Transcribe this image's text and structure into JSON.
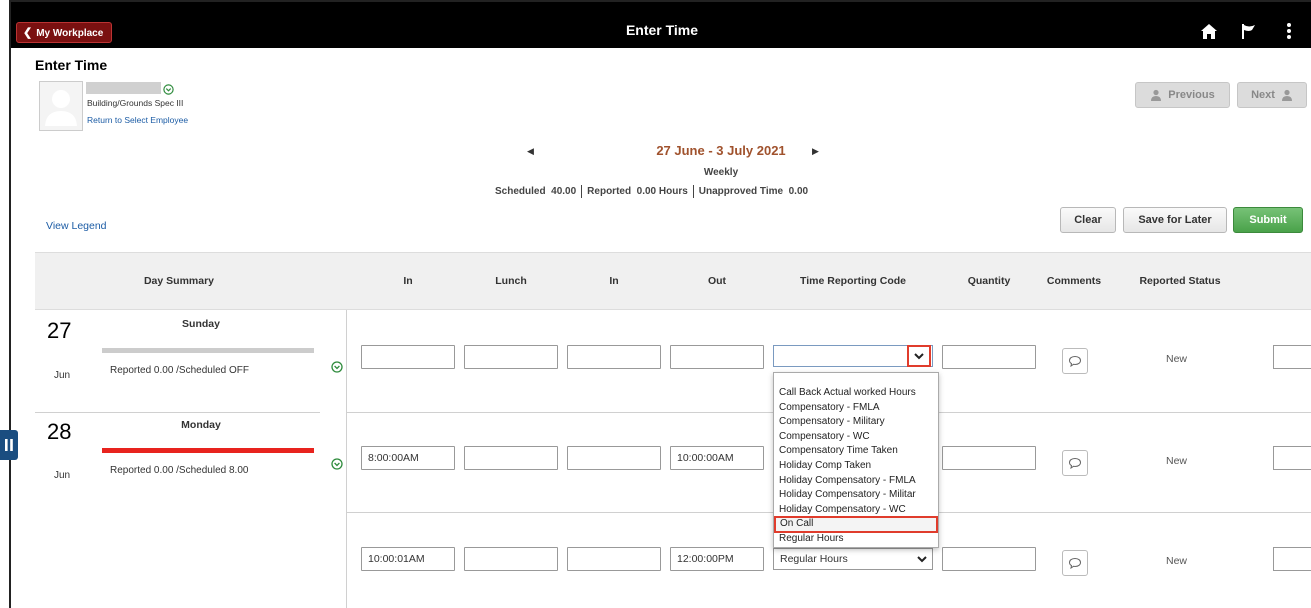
{
  "header": {
    "back_label": "My Workplace",
    "title": "Enter Time"
  },
  "page": {
    "title": "Enter Time"
  },
  "employee": {
    "job_title": "Building/Grounds Spec III",
    "return_link": "Return to Select Employee"
  },
  "nav": {
    "previous": "Previous",
    "next": "Next"
  },
  "period": {
    "range": "27 June - 3 July 2021",
    "view": "Weekly"
  },
  "summary": {
    "scheduled_label": "Scheduled",
    "scheduled_value": "40.00",
    "reported_label": "Reported",
    "reported_value": "0.00 Hours",
    "unapproved_label": "Unapproved Time",
    "unapproved_value": "0.00"
  },
  "actions": {
    "view_legend": "View Legend",
    "clear": "Clear",
    "save_for_later": "Save for Later",
    "submit": "Submit"
  },
  "columns": [
    "Day Summary",
    "In",
    "Lunch",
    "In",
    "Out",
    "Time Reporting Code",
    "Quantity",
    "Comments",
    "Reported Status"
  ],
  "days": [
    {
      "num": "27",
      "month": "Jun",
      "name": "Sunday",
      "reported": "Reported 0.00 /Scheduled OFF",
      "bar_color": "#cccccc"
    },
    {
      "num": "28",
      "month": "Jun",
      "name": "Monday",
      "reported": "Reported 0.00 /Scheduled 8.00",
      "bar_color": "#e8231e"
    }
  ],
  "rows": [
    {
      "in": "",
      "lunch": "",
      "in2": "",
      "out": "",
      "trc": "",
      "status": "New"
    },
    {
      "in": "8:00:00AM",
      "lunch": "",
      "in2": "",
      "out": "10:00:00AM",
      "trc": "",
      "status": "New"
    },
    {
      "in": "10:00:01AM",
      "lunch": "",
      "in2": "",
      "out": "12:00:00PM",
      "trc": "Regular Hours",
      "status": "New"
    }
  ],
  "trc_options": [
    "Call Back Actual worked Hours",
    "Compensatory - FMLA",
    "Compensatory - Military",
    "Compensatory - WC",
    "Compensatory Time Taken",
    "Holiday Comp Taken",
    "Holiday Compensatory - FMLA",
    "Holiday Compensatory - Militar",
    "Holiday Compensatory - WC",
    "On Call",
    "Regular Hours"
  ],
  "highlighted_option": "On Call",
  "colors": {
    "header_bg": "#000000",
    "back_btn": "#7a1010",
    "period_text": "#a0522d",
    "submit": "#4aa24a",
    "highlight": "#e03c2c",
    "link": "#1c5ca5"
  }
}
